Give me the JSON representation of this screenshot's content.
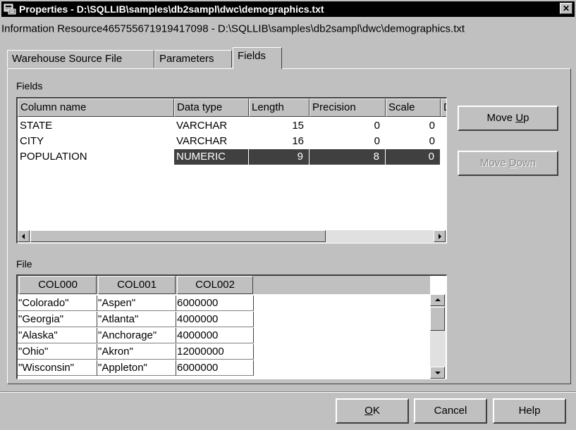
{
  "window": {
    "title": "Properties - D:\\SQLLIB\\samples\\db2sampl\\dwc\\demographics.txt",
    "close_glyph": "✕"
  },
  "resource_line": "Information Resource465755671919417098 - D:\\SQLLIB\\samples\\db2sampl\\dwc\\demographics.txt",
  "tabs": [
    {
      "label": "Warehouse Source File"
    },
    {
      "label": "Parameters"
    },
    {
      "label": "Fields",
      "active": true
    }
  ],
  "fields_group": {
    "label": "Fields",
    "columns": [
      "Column name",
      "Data type",
      "Length",
      "Precision",
      "Scale",
      "D"
    ],
    "rows": [
      [
        "STATE",
        "VARCHAR",
        "15",
        "0",
        "0"
      ],
      [
        "CITY",
        "VARCHAR",
        "16",
        "0",
        "0"
      ],
      [
        "POPULATION",
        "NUMERIC",
        "9",
        "8",
        "0"
      ]
    ],
    "selected_row": 2
  },
  "side_buttons": {
    "move_up": {
      "pre": "Move ",
      "key": "U",
      "post": "p"
    },
    "move_down": {
      "pre": "Move ",
      "key": "D",
      "post": "own",
      "disabled": true
    }
  },
  "file_group": {
    "label": "File",
    "columns": [
      "COL000",
      "COL001",
      "COL002"
    ],
    "rows": [
      [
        "\"Colorado\"",
        "\"Aspen\"",
        "6000000"
      ],
      [
        "\"Georgia\"",
        "\"Atlanta\"",
        "4000000"
      ],
      [
        "\"Alaska\"",
        "\"Anchorage\"",
        "4000000"
      ],
      [
        "\"Ohio\"",
        "\"Akron\"",
        "12000000"
      ],
      [
        "\"Wisconsin\"",
        "\"Appleton\"",
        "6000000"
      ]
    ]
  },
  "dialog_buttons": {
    "ok": {
      "key": "O",
      "post": "K"
    },
    "cancel": "Cancel",
    "help": "Help"
  },
  "colors": {
    "face": "#c0c0c0",
    "selection": "#404040",
    "titlebar": "#000000"
  }
}
